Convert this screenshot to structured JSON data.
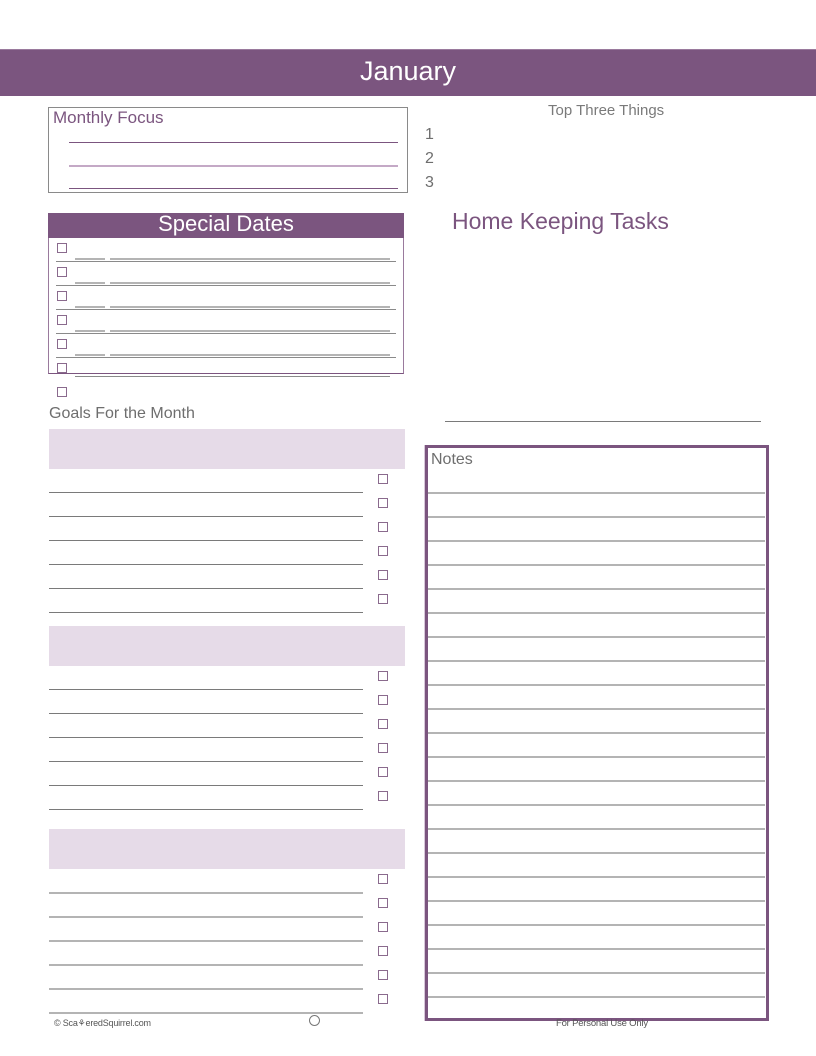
{
  "page": {
    "month_title": "January"
  },
  "monthly_focus": {
    "title": "Monthly Focus",
    "lines": 3
  },
  "top_three": {
    "title": "Top Three Things",
    "items": [
      "1",
      "2",
      "3"
    ]
  },
  "special_dates": {
    "title": "Special Dates",
    "rows": 7
  },
  "goals": {
    "title": "Goals For the Month",
    "groups": [
      {
        "tasks": 6
      },
      {
        "tasks": 6
      },
      {
        "tasks": 6
      }
    ]
  },
  "home_keeping": {
    "title": "Home Keeping Tasks"
  },
  "notes": {
    "title": "Notes",
    "lines": 22
  },
  "footer": {
    "copyright": "© ScatteredSquirrel.com",
    "copyright_display": "© Sca⚘eredSquirrel.com",
    "usage": "For Personal Use Only"
  },
  "colors": {
    "accent": "#7b557f",
    "accent_light": "#e6dbe8",
    "text_gray": "#6e6e6e",
    "rule_gray": "#b4b4b4"
  }
}
